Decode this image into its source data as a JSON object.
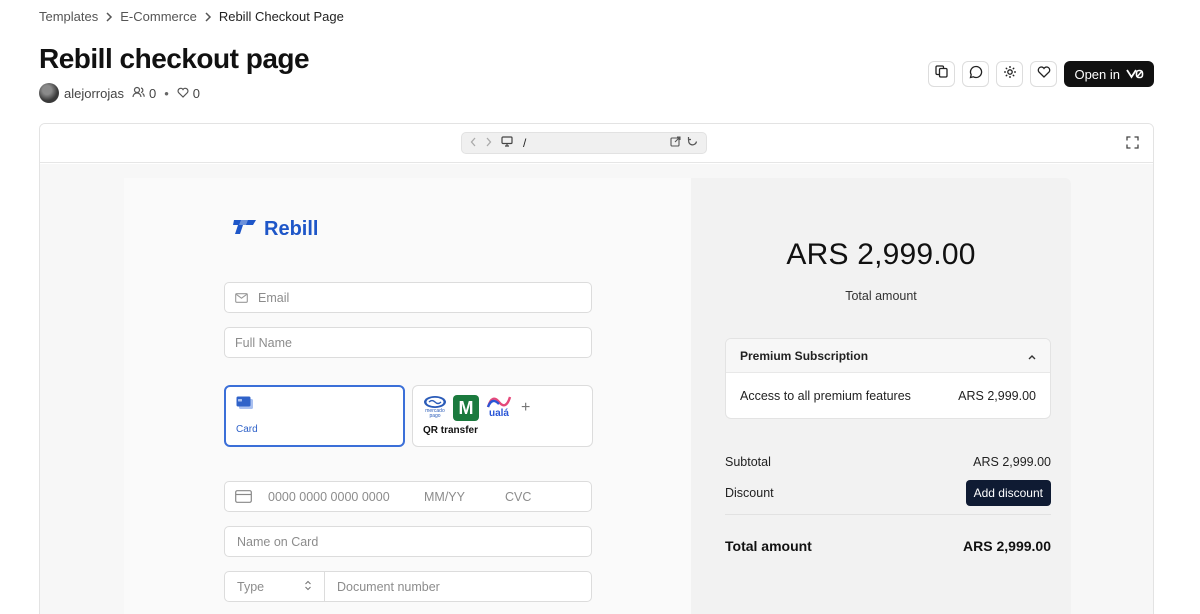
{
  "breadcrumb": {
    "items": [
      "Templates",
      "E-Commerce",
      "Rebill Checkout Page"
    ]
  },
  "page": {
    "title": "Rebill checkout page",
    "author": "alejorrojas",
    "users_count": "0",
    "likes_count": "0"
  },
  "actions": {
    "open_in_label": "Open in"
  },
  "preview": {
    "url_path": "/"
  },
  "checkout": {
    "brand": "Rebill",
    "email_placeholder": "Email",
    "fullname_placeholder": "Full Name",
    "payment_options": {
      "card_label": "Card",
      "qr_label": "QR transfer",
      "mp_text_top": "mercado",
      "mp_text_bottom": "pago",
      "uala_text": "ualá"
    },
    "card_number_placeholder": "0000 0000 0000 0000",
    "expiry_placeholder": "MM/YY",
    "cvc_placeholder": "CVC",
    "name_on_card_placeholder": "Name on Card",
    "doc_type_label": "Type",
    "doc_number_placeholder": "Document number"
  },
  "summary": {
    "total_big": "ARS 2,999.00",
    "total_caption": "Total amount",
    "plan_title": "Premium Subscription",
    "plan_desc": "Access to all premium features",
    "plan_price": "ARS 2,999.00",
    "subtotal_label": "Subtotal",
    "subtotal_value": "ARS 2,999.00",
    "discount_label": "Discount",
    "discount_button": "Add discount",
    "total_label": "Total amount",
    "total_value": "ARS 2,999.00"
  },
  "colors": {
    "brand_blue": "#1e56c8",
    "dark_button": "#111111",
    "discount_button": "#0f1b33"
  }
}
